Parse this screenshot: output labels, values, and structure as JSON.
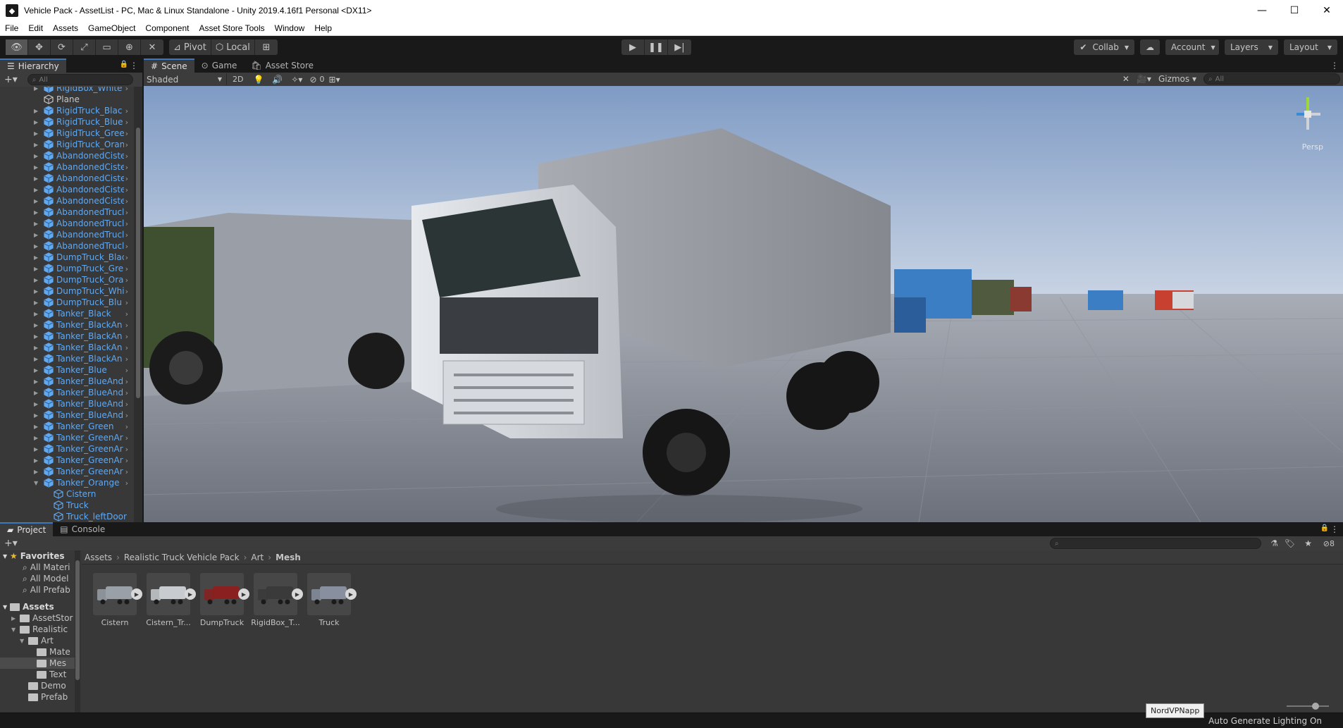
{
  "window": {
    "title": "Vehicle Pack - AssetList - PC, Mac & Linux Standalone - Unity 2019.4.16f1 Personal <DX11>",
    "minimize": "—",
    "maximize": "☐",
    "close": "✕"
  },
  "menu": [
    "File",
    "Edit",
    "Assets",
    "GameObject",
    "Component",
    "Asset Store Tools",
    "Window",
    "Help"
  ],
  "toolbar": {
    "pivot": "Pivot",
    "local": "Local",
    "collab": "Collab",
    "account": "Account",
    "layers": "Layers",
    "layout": "Layout"
  },
  "hierarchy": {
    "tab": "Hierarchy",
    "search_placeholder": "All",
    "items": [
      {
        "label": "RigidBox_White",
        "blue": true,
        "expand": true
      },
      {
        "label": "Plane",
        "blue": false,
        "expand": false
      },
      {
        "label": "RigidTruck_Blac",
        "blue": true,
        "expand": true
      },
      {
        "label": "RigidTruck_Blue",
        "blue": true,
        "expand": true
      },
      {
        "label": "RigidTruck_Gree",
        "blue": true,
        "expand": true
      },
      {
        "label": "RigidTruck_Oran",
        "blue": true,
        "expand": true
      },
      {
        "label": "AbandonedCiste",
        "blue": true,
        "expand": true
      },
      {
        "label": "AbandonedCiste",
        "blue": true,
        "expand": true
      },
      {
        "label": "AbandonedCiste",
        "blue": true,
        "expand": true
      },
      {
        "label": "AbandonedCiste",
        "blue": true,
        "expand": true
      },
      {
        "label": "AbandonedCiste",
        "blue": true,
        "expand": true
      },
      {
        "label": "AbandonedTrucl",
        "blue": true,
        "expand": true
      },
      {
        "label": "AbandonedTrucl",
        "blue": true,
        "expand": true
      },
      {
        "label": "AbandonedTrucl",
        "blue": true,
        "expand": true
      },
      {
        "label": "AbandonedTrucl",
        "blue": true,
        "expand": true
      },
      {
        "label": "DumpTruck_Blac",
        "blue": true,
        "expand": true
      },
      {
        "label": "DumpTruck_Gre",
        "blue": true,
        "expand": true
      },
      {
        "label": "DumpTruck_Ora",
        "blue": true,
        "expand": true
      },
      {
        "label": "DumpTruck_Whi",
        "blue": true,
        "expand": true
      },
      {
        "label": "DumpTruck_Blu",
        "blue": true,
        "expand": true
      },
      {
        "label": "Tanker_Black",
        "blue": true,
        "expand": true
      },
      {
        "label": "Tanker_BlackAn",
        "blue": true,
        "expand": true
      },
      {
        "label": "Tanker_BlackAn",
        "blue": true,
        "expand": true
      },
      {
        "label": "Tanker_BlackAn",
        "blue": true,
        "expand": true
      },
      {
        "label": "Tanker_BlackAn",
        "blue": true,
        "expand": true
      },
      {
        "label": "Tanker_Blue",
        "blue": true,
        "expand": true
      },
      {
        "label": "Tanker_BlueAnd",
        "blue": true,
        "expand": true
      },
      {
        "label": "Tanker_BlueAnd",
        "blue": true,
        "expand": true
      },
      {
        "label": "Tanker_BlueAnd",
        "blue": true,
        "expand": true
      },
      {
        "label": "Tanker_BlueAnd",
        "blue": true,
        "expand": true
      },
      {
        "label": "Tanker_Green",
        "blue": true,
        "expand": true
      },
      {
        "label": "Tanker_GreenAr",
        "blue": true,
        "expand": true
      },
      {
        "label": "Tanker_GreenAr",
        "blue": true,
        "expand": true
      },
      {
        "label": "Tanker_GreenAr",
        "blue": true,
        "expand": true
      },
      {
        "label": "Tanker_GreenAr",
        "blue": true,
        "expand": true
      },
      {
        "label": "Tanker_Orange",
        "blue": true,
        "expand": true,
        "open": true
      },
      {
        "label": "Cistern",
        "blue": true,
        "expand": false,
        "child": true
      },
      {
        "label": "Truck",
        "blue": true,
        "expand": false,
        "child": true
      },
      {
        "label": "Truck_leftDoor",
        "blue": true,
        "expand": false,
        "child": true
      }
    ]
  },
  "scene": {
    "tabs": [
      "Scene",
      "Game",
      "Asset Store"
    ],
    "shading": "Shaded",
    "mode_2d": "2D",
    "hidden_count": "0",
    "gizmos": "Gizmos",
    "search_placeholder": "All",
    "persp": "Persp"
  },
  "project": {
    "tabs": [
      "Project",
      "Console"
    ],
    "hidden_count": "8",
    "favorites_label": "Favorites",
    "favorites": [
      "All Materi",
      "All Model",
      "All Prefab"
    ],
    "assets_label": "Assets",
    "tree": [
      {
        "label": "AssetStor",
        "indent": 1
      },
      {
        "label": "Realistic ",
        "indent": 1
      },
      {
        "label": "Art",
        "indent": 2
      },
      {
        "label": "Mate",
        "indent": 3
      },
      {
        "label": "Mes",
        "indent": 3,
        "selected": true
      },
      {
        "label": "Text",
        "indent": 3
      },
      {
        "label": "Demo",
        "indent": 2
      },
      {
        "label": "Prefab",
        "indent": 2
      }
    ],
    "breadcrumb": [
      "Assets",
      "Realistic Truck Vehicle Pack",
      "Art",
      "Mesh"
    ],
    "items": [
      {
        "name": "Cistern",
        "color": "#9aa0a8"
      },
      {
        "name": "Cistern_Tr...",
        "color": "#c8ccd0"
      },
      {
        "name": "DumpTruck",
        "color": "#8a2020"
      },
      {
        "name": "RigidBox_T...",
        "color": "#3a3a3a"
      },
      {
        "name": "Truck",
        "color": "#8890a0"
      }
    ]
  },
  "status": {
    "text": "Auto Generate Lighting On",
    "tooltip": "NordVPNapp"
  }
}
